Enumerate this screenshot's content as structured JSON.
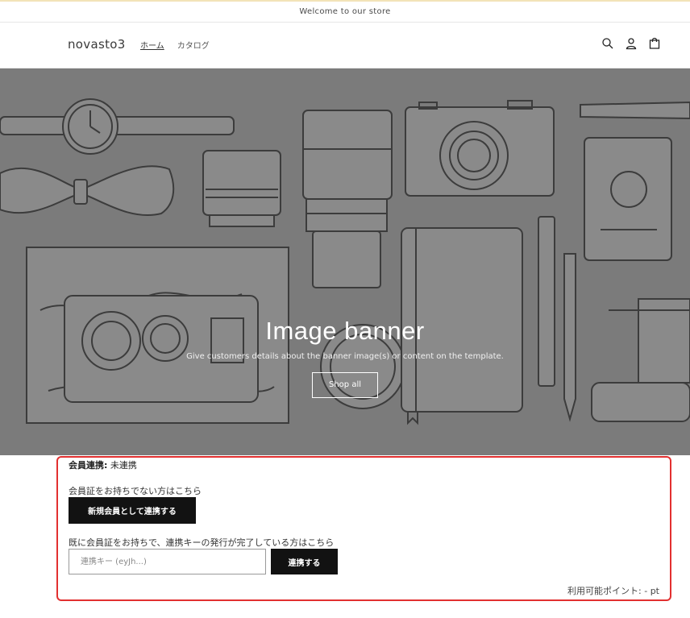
{
  "announcement": {
    "text": "Welcome to our store"
  },
  "header": {
    "logo": "novasto3",
    "nav": [
      {
        "label": "ホーム",
        "active": true
      },
      {
        "label": "カタログ",
        "active": false
      }
    ],
    "icons": [
      "search-icon",
      "account-icon",
      "cart-icon"
    ]
  },
  "banner": {
    "title": "Image banner",
    "subtitle": "Give customers details about the banner image(s) or content on the template.",
    "button_label": "Shop all"
  },
  "member": {
    "status_label": "会員連携:",
    "status_value": "未連携",
    "no_card_text": "会員証をお持ちでない方はこちら",
    "register_button": "新規会員として連携する",
    "has_card_text": "既に会員証をお持ちで、連携キーの発行が完了している方はこちら",
    "key_placeholder": "連携キー (eyJh...)",
    "link_button": "連携する",
    "points_text": "利用可能ポイント: - pt"
  },
  "colors": {
    "banner_bg": "#7b7b7b",
    "button_dark": "#121212",
    "highlight_border": "#e23030",
    "announcement_border": "#f3e3b8"
  }
}
